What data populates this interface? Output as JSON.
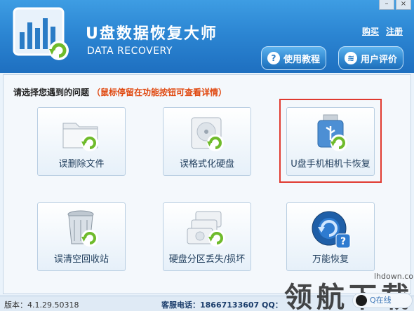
{
  "window": {
    "title_cn": "U盘数据恢复大师",
    "title_en": "DATA RECOVERY",
    "controls": {
      "minimize": "–",
      "close": "×"
    }
  },
  "header": {
    "links": {
      "buy": "购买",
      "register": "注册"
    },
    "buttons": {
      "tutorial": {
        "icon": "?",
        "label": "使用教程"
      },
      "reviews": {
        "icon": "≋",
        "label": "用户评价"
      }
    }
  },
  "main": {
    "prompt": "请选择您遇到的问题",
    "hint": "（鼠标停留在功能按钮可查看详情）",
    "tiles": [
      {
        "label": "误删除文件",
        "icon": "folder-recover-icon"
      },
      {
        "label": "误格式化硬盘",
        "icon": "hdd-recover-icon"
      },
      {
        "label": "U盘手机相机卡恢复",
        "icon": "usb-recover-icon"
      },
      {
        "label": "误清空回收站",
        "icon": "recycle-bin-icon"
      },
      {
        "label": "硬盘分区丢失/损坏",
        "icon": "partition-recover-icon"
      },
      {
        "label": "万能恢复",
        "icon": "universal-recover-icon"
      }
    ]
  },
  "status": {
    "version": "版本：4.1.29.50318",
    "phone": "客服电话：18667133607  QQ："
  },
  "watermark": {
    "text": "领航下载",
    "site": "lhdown.com",
    "badge": "Q在线"
  },
  "colors": {
    "header": "#2c86d3",
    "hint": "#e0480f",
    "selection": "#e03a30",
    "recover_arrow": "#6fbb2b"
  }
}
